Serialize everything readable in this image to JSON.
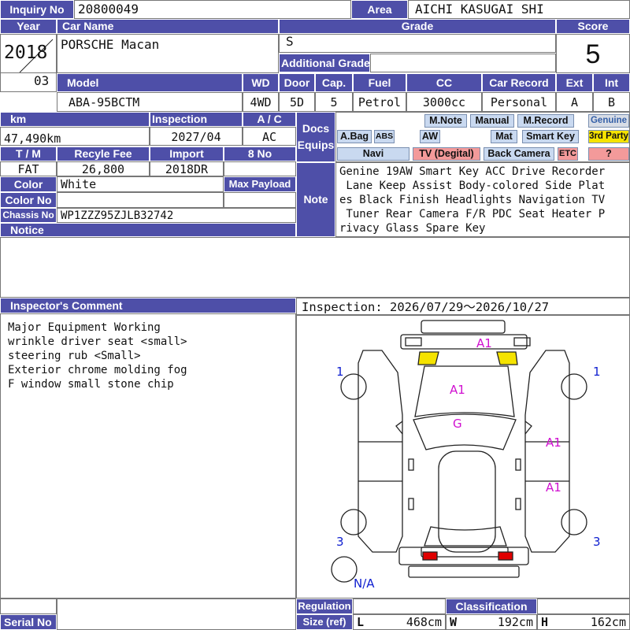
{
  "header": {
    "inquiry_label": "Inquiry No",
    "inquiry_value": "20800049",
    "area_label": "Area",
    "area_value": "AICHI KASUGAI SHI"
  },
  "row1": {
    "year_label": "Year",
    "car_name_label": "Car Name",
    "grade_label": "Grade",
    "score_label": "Score",
    "year_value": "2018",
    "month_value": "03",
    "car_name_value": "PORSCHE Macan",
    "grade_value": "S",
    "additional_grade_label": "Additional Grade",
    "score_value": "5"
  },
  "spec": {
    "model_label": "Model",
    "wd_label": "WD",
    "door_label": "Door",
    "cap_label": "Cap.",
    "fuel_label": "Fuel",
    "cc_label": "CC",
    "car_record_label": "Car Record",
    "ext_label": "Ext",
    "int_label": "Int",
    "model_value": "ABA-95BCTM",
    "wd_value": "4WD",
    "door_value": "5D",
    "cap_value": "5",
    "fuel_value": "Petrol",
    "cc_value": "3000cc",
    "car_record_value": "Personal",
    "ext_value": "A",
    "int_value": "B"
  },
  "details": {
    "km_label": "km",
    "inspection_label": "Inspection",
    "ac_label": "A / C",
    "km_value": "47,490km",
    "inspection_value": "2027/04",
    "ac_value": "AC",
    "tm_label": "T / M",
    "recycle_label": "Recyle Fee",
    "import_label": "Import",
    "eightno_label": "8 No",
    "tm_value": "FAT",
    "recycle_value": "26,800",
    "import_value": "2018DR",
    "eightno_value": "",
    "color_label": "Color",
    "color_value": "White",
    "max_payload_label": "Max Payload",
    "colorno_label": "Color No",
    "colorno_value": "",
    "chassis_label": "Chassis No",
    "chassis_value": "WP1ZZZ95ZJLB32742",
    "notice_label": "Notice",
    "notice_value": ""
  },
  "docs": {
    "label": "Docs Equips",
    "badges": {
      "mnote": "M.Note",
      "manual": "Manual",
      "mrecord": "M.Record",
      "genuine": "Genuine",
      "abag": "A.Bag",
      "abs": "ABS",
      "aw": "AW",
      "mat": "Mat",
      "smartkey": "Smart Key",
      "thirdparty": "3rd Party",
      "navi": "Navi",
      "tv": "TV (Degital)",
      "backcamera": "Back Camera",
      "etc": "ETC",
      "question": "?"
    }
  },
  "note": {
    "label": "Note",
    "lines": [
      "Genine 19AW Smart Key ACC Drive Recorder",
      " Lane Keep Assist Body-colored Side Plat",
      "es Black Finish Headlights Navigation TV",
      " Tuner Rear Camera F/R PDC Seat Heater P",
      "rivacy Glass Spare Key"
    ]
  },
  "inspector": {
    "label": "Inspector's Comment",
    "lines": [
      "Major Equipment Working",
      "wrinkle driver seat <small>",
      "steering rub <Small>",
      "Exterior chrome molding fog",
      "F window small stone chip"
    ]
  },
  "inspection_period": "Inspection: 2026/07/29～2026/10/27",
  "diagram_marks": {
    "front_bumper": "A1",
    "hood": "A1",
    "windshield": "G",
    "right_front_door": "A1",
    "right_rear_door": "A1",
    "left_front_wheel": "1",
    "right_front_wheel": "1",
    "left_rear_wheel": "3",
    "right_rear_wheel": "3",
    "spare_tire": "N/A"
  },
  "footer": {
    "serial_label": "Serial No",
    "serial_value": "",
    "regulation_label": "Regulation",
    "size_label": "Size (ref)",
    "classification_label": "Classification",
    "l_label": "L",
    "l_value": "468cm",
    "w_label": "W",
    "w_value": "192cm",
    "h_label": "H",
    "h_value": "162cm"
  },
  "colors": {
    "header_bg": "#4e4fa8",
    "badge_blue": "#c9d9f0",
    "badge_red": "#f39a9a",
    "badge_yellow": "#f5e300",
    "damage_mark": "#d010d0",
    "wheel_mark": "#1020d0"
  }
}
